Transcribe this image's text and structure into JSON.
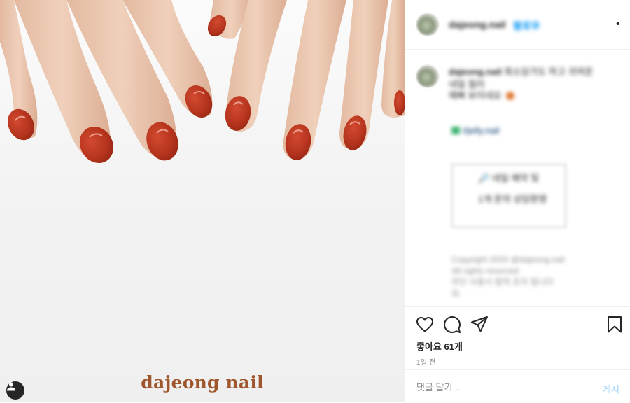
{
  "post": {
    "image_alt": "red glossy nails on white background",
    "brand_watermark": "dajeong nail"
  },
  "header": {
    "username": "dajeong.nail",
    "follow_label": "팔로우",
    "more_label": "•"
  },
  "caption": {
    "username": "dajeong.nail",
    "line1": "회소담가도 하고 귀여운",
    "line2": "네일 컬러",
    "line3": "예뻐 보이네요",
    "event_line": "#jelly.nail",
    "notice_line1": "🔎 네일 예약 및",
    "notice_line2": "1개 문의 상담환영",
    "copyright_line1": "Copyright 2020 @dajeong.nail",
    "copyright_line2": "All rights reserved",
    "copyright_line3": "무단 사용시 법적 조치 됩니다",
    "copyright_line4": "요."
  },
  "actions": {
    "likes": "좋아요 61개",
    "time": "1일 전"
  },
  "comment": {
    "placeholder": "댓글 달기...",
    "post_label": "게시"
  },
  "colors": {
    "nail_polish": "#b5331d",
    "brand_text": "#a0562c",
    "follow_blue": "#0095f6",
    "post_disabled": "#b2dffc"
  },
  "icons": [
    "user-tag-icon",
    "heart-icon",
    "comment-icon",
    "share-icon",
    "bookmark-icon",
    "more-icon"
  ]
}
